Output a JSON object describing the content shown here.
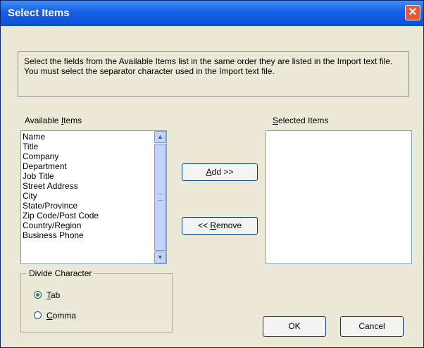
{
  "window": {
    "title": "Select Items",
    "close_glyph": "✕"
  },
  "info": {
    "line1": "Select the fields from the Available Items list in the same order they are listed in the Import text file.",
    "line2": "You must select the separator character used in the Import text file."
  },
  "available": {
    "label_pre": "Available ",
    "label_hot": "I",
    "label_post": "tems",
    "items": [
      "Name",
      "Title",
      "Company",
      "Department",
      "Job Title",
      "Street Address",
      "City",
      "State/Province",
      "Zip Code/Post Code",
      "Country/Region",
      "Business Phone"
    ]
  },
  "selected": {
    "label_hot": "S",
    "label_post": "elected Items"
  },
  "buttons": {
    "add_hot": "A",
    "add_post": "dd >>",
    "remove_pre": "<< ",
    "remove_hot": "R",
    "remove_post": "emove",
    "ok": "OK",
    "cancel": "Cancel"
  },
  "divide": {
    "title": "Divide Character",
    "tab_hot": "T",
    "tab_post": "ab",
    "comma_hot": "C",
    "comma_post": "omma",
    "selected": "Tab"
  },
  "icons": {
    "scroll_up": "scroll-up-arrow-icon",
    "scroll_down": "scroll-down-arrow-icon",
    "close": "close-icon"
  },
  "colors": {
    "titlebar": "#0b4fd8",
    "window_bg": "#ece9d8",
    "close_btn": "#e8573a"
  }
}
